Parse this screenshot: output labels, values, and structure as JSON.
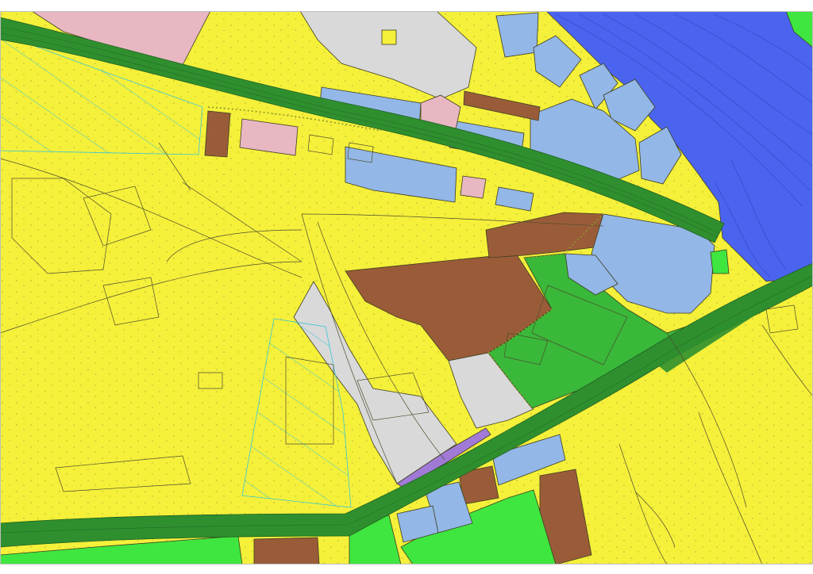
{
  "map": {
    "type": "land-use zoning plan",
    "legend_colors": {
      "residential_yellow": "#f5f03a",
      "green_space": "#39b839",
      "bright_green": "#3fe63f",
      "railway_blue": "#4b64ef",
      "public_services_lightblue": "#93b7e6",
      "commercial_brown": "#9a5c38",
      "special_pink": "#e8b7c2",
      "unassigned_grey": "#d9d9d9",
      "road_dark_green": "#2f8f2f",
      "purple_strip": "#a07ad6"
    }
  }
}
